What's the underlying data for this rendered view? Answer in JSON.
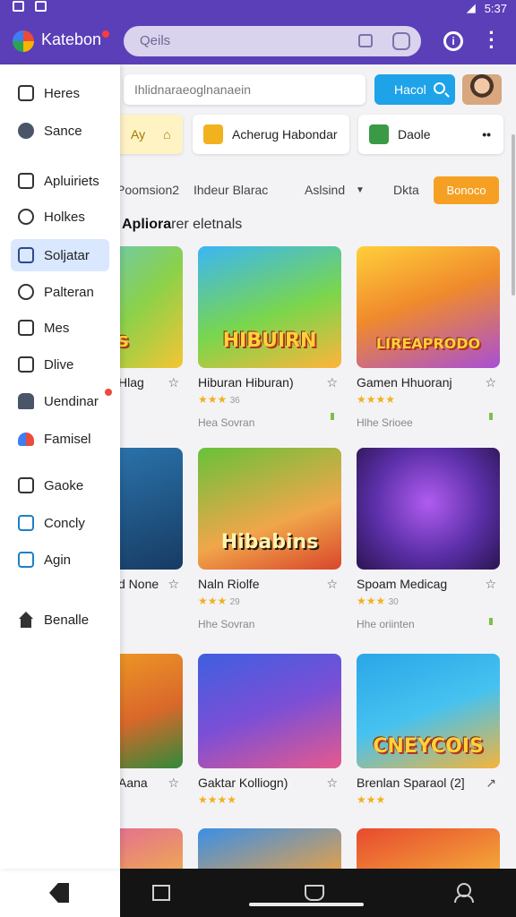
{
  "status_bar": {
    "time": "5:37"
  },
  "app_bar": {
    "app_name": "Katebon",
    "search_placeholder": "Qeils"
  },
  "drawer": {
    "items": [
      {
        "label": "Heres",
        "icon": "bookmark-icon"
      },
      {
        "label": "Sance",
        "icon": "s-circle-icon"
      },
      {
        "label": "Apluiriets",
        "icon": "square-icon"
      },
      {
        "label": "Holkes",
        "icon": "power-icon"
      },
      {
        "label": "Soljatar",
        "icon": "grid-icon",
        "selected": true
      },
      {
        "label": "Palteran",
        "icon": "clock-icon"
      },
      {
        "label": "Mes",
        "icon": "message-icon"
      },
      {
        "label": "Dlive",
        "icon": "table-icon"
      },
      {
        "label": "Uendinar",
        "icon": "pin-icon",
        "badge": true
      },
      {
        "label": "Famisel",
        "icon": "heart-icon"
      },
      {
        "label": "Gaoke",
        "icon": "check-square-icon"
      },
      {
        "label": "Concly",
        "icon": "chart-icon"
      },
      {
        "label": "Agin",
        "icon": "edit-icon"
      },
      {
        "label": "Benalle",
        "icon": "home-icon"
      }
    ]
  },
  "main": {
    "search": {
      "placeholder": "Ihlidnaraeoglnanaein"
    },
    "search_button": "Hacol",
    "chips": [
      {
        "label": "Ay",
        "icon": "bag-icon"
      },
      {
        "label": "Acherug Habondar",
        "icon": "cube-icon"
      },
      {
        "label": "Daole",
        "icon": "gift-icon"
      }
    ],
    "filters": [
      "Poomsion2",
      "Ihdeur Blarac",
      "Aslsind",
      "Dkta"
    ],
    "filter_button": "Bonoco",
    "section_title": {
      "bold": "Apliora",
      "rest": "rer eletnals"
    },
    "games": [
      {
        "title": "Hlag",
        "thumb_text": "Ois",
        "rating_count": "",
        "subtitle": ""
      },
      {
        "title": "Hiburan Hiburan)",
        "thumb_text": "HIBUIRN",
        "rating_count": "36",
        "subtitle": "Hea Sovran"
      },
      {
        "title": "Gamen Hhuoranj",
        "thumb_text": "LIREAPRODO",
        "rating_count": "",
        "subtitle": "Hlhe Srioee"
      },
      {
        "title": "d None",
        "thumb_text": "",
        "rating_count": "",
        "subtitle": ""
      },
      {
        "title": "Naln Riolfe",
        "thumb_text": "Hibabins",
        "rating_count": "29",
        "subtitle": "Hhe Sovran"
      },
      {
        "title": "Spoam Medicag",
        "thumb_text": "",
        "rating_count": "30",
        "subtitle": "Hhe oriinten"
      },
      {
        "title": "Aana",
        "thumb_text": "",
        "rating_count": "",
        "subtitle": ""
      },
      {
        "title": "Gaktar Kolliogn)",
        "thumb_text": "",
        "rating_count": "",
        "subtitle": ""
      },
      {
        "title": "Brenlan Sparaol (2]",
        "thumb_text": "CNEYCOIS",
        "rating_count": "",
        "subtitle": ""
      }
    ]
  },
  "colors": {
    "primary": "#5b3fb8",
    "accent_blue": "#1ea3e8",
    "accent_orange": "#f5a023",
    "selected_bg": "#d9e7ff"
  }
}
